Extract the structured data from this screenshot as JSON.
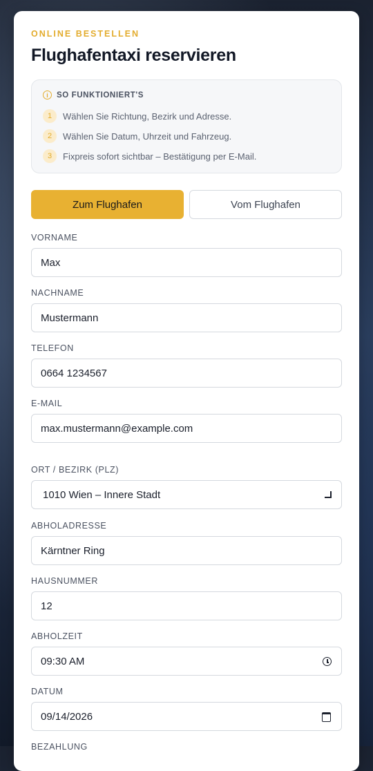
{
  "header": {
    "eyebrow": "ONLINE BESTELLEN",
    "title": "Flughafentaxi reservieren"
  },
  "info": {
    "title": "SO FUNKTIONIERT'S",
    "icon": "info-icon",
    "steps": [
      {
        "num": "1",
        "text": "Wählen Sie Richtung, Bezirk und Adresse."
      },
      {
        "num": "2",
        "text": "Wählen Sie Datum, Uhrzeit und Fahrzeug."
      },
      {
        "num": "3",
        "text": "Fixpreis sofort sichtbar – Bestätigung per E-Mail."
      }
    ]
  },
  "direction": {
    "to": "Zum Flughafen",
    "from": "Vom Flughafen",
    "selected": "Zum Flughafen"
  },
  "form": {
    "vorname": {
      "label": "VORNAME",
      "value": "Max"
    },
    "nachname": {
      "label": "NACHNAME",
      "value": "Mustermann"
    },
    "telefon": {
      "label": "TELEFON",
      "value": "0664 1234567"
    },
    "email": {
      "label": "E-MAIL",
      "value": "max.mustermann@example.com"
    },
    "ort": {
      "label": "ORT / BEZIRK (PLZ)",
      "value": "1010 Wien – Innere Stadt"
    },
    "adresse": {
      "label": "ABHOLADRESSE",
      "value": "Kärntner Ring"
    },
    "hausnummer": {
      "label": "HAUSNUMMER",
      "value": "12"
    },
    "abholzeit": {
      "label": "ABHOLZEIT",
      "value": "09:30 AM"
    },
    "datum": {
      "label": "DATUM",
      "value": "09/14/2026"
    },
    "bezahlung": {
      "label": "BEZAHLUNG"
    }
  },
  "colors": {
    "accent": "#e8b132",
    "eyebrow": "#e3ac2d",
    "title": "#121826"
  }
}
